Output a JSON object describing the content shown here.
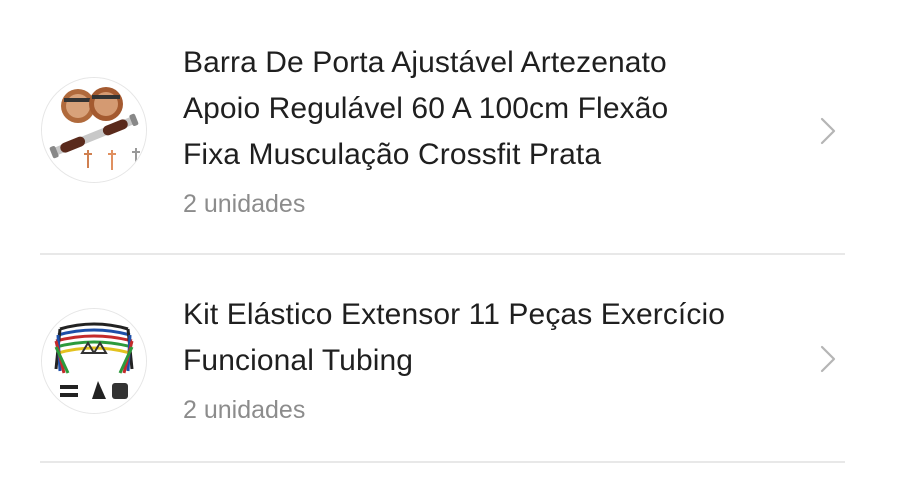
{
  "purchase_items": [
    {
      "title_lines": [
        "Barra De Porta Ajustável Artezenato",
        "Apoio Regulável 60 A 100cm Flexão",
        "Fixa Musculação Crossfit Prata"
      ],
      "quantity": "2 unidades",
      "thumbnail_icon": "door-pull-up-bar-photo",
      "action_icon": "chevron-right-icon"
    },
    {
      "title_lines": [
        "Kit Elástico Extensor 11 Peças Exercício",
        "Funcional Tubing"
      ],
      "quantity": "2 unidades",
      "thumbnail_icon": "resistance-bands-kit-photo",
      "action_icon": "chevron-right-icon"
    }
  ],
  "colors": {
    "title": "#1f1f1f",
    "quantity": "#8c8c8c",
    "chevron": "#b5b5b5",
    "divider": "#e8e8e8"
  }
}
